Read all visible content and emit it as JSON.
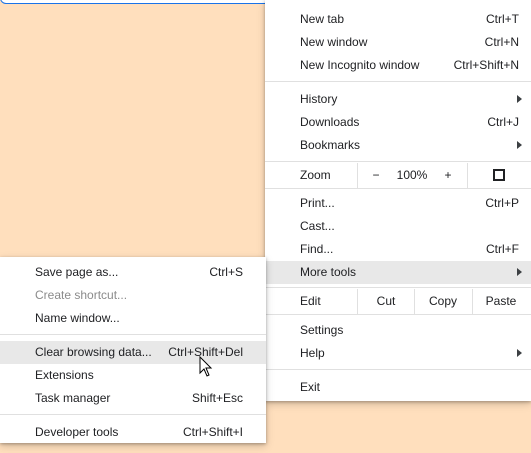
{
  "main_menu": {
    "new_tab": {
      "label": "New tab",
      "shortcut": "Ctrl+T"
    },
    "new_window": {
      "label": "New window",
      "shortcut": "Ctrl+N"
    },
    "new_incognito": {
      "label": "New Incognito window",
      "shortcut": "Ctrl+Shift+N"
    },
    "history": {
      "label": "History"
    },
    "downloads": {
      "label": "Downloads",
      "shortcut": "Ctrl+J"
    },
    "bookmarks": {
      "label": "Bookmarks"
    },
    "zoom": {
      "label": "Zoom",
      "minus": "−",
      "level": "100%",
      "plus": "+",
      "fullscreen_icon": "fullscreen-icon"
    },
    "print": {
      "label": "Print...",
      "shortcut": "Ctrl+P"
    },
    "cast": {
      "label": "Cast..."
    },
    "find": {
      "label": "Find...",
      "shortcut": "Ctrl+F"
    },
    "more_tools": {
      "label": "More tools"
    },
    "edit": {
      "label": "Edit",
      "cut": "Cut",
      "copy": "Copy",
      "paste": "Paste"
    },
    "settings": {
      "label": "Settings"
    },
    "help": {
      "label": "Help"
    },
    "exit": {
      "label": "Exit"
    }
  },
  "sub_menu": {
    "save_page": {
      "label": "Save page as...",
      "shortcut": "Ctrl+S"
    },
    "create_shortcut": {
      "label": "Create shortcut..."
    },
    "name_window": {
      "label": "Name window..."
    },
    "clear_browsing": {
      "label": "Clear browsing data...",
      "shortcut": "Ctrl+Shift+Del"
    },
    "extensions": {
      "label": "Extensions"
    },
    "task_manager": {
      "label": "Task manager",
      "shortcut": "Shift+Esc"
    },
    "developer_tools": {
      "label": "Developer tools",
      "shortcut": "Ctrl+Shift+I"
    }
  },
  "colors": {
    "background": "#ffdfbd",
    "menu": "#ffffff",
    "highlight": "#e8e8e8",
    "disabled_text": "#8b8b8b",
    "focus": "#1a73e8"
  }
}
